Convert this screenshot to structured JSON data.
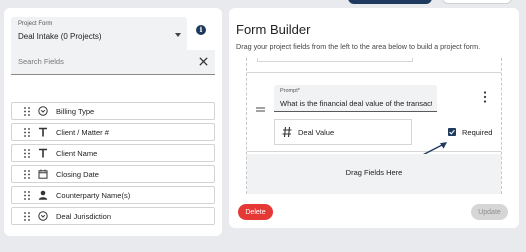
{
  "left_panel": {
    "project_form": {
      "label": "Project Form",
      "value": "Deal Intake (0 Projects)"
    },
    "search": {
      "placeholder": "Search Fields"
    },
    "fields": [
      {
        "label": "Billing Type",
        "icon": "dropdown-circle-icon"
      },
      {
        "label": "Client / Matter #",
        "icon": "text-t-icon"
      },
      {
        "label": "Client Name",
        "icon": "text-t-icon"
      },
      {
        "label": "Closing Date",
        "icon": "calendar-icon"
      },
      {
        "label": "Counterparty Name(s)",
        "icon": "person-icon"
      },
      {
        "label": "Deal Jurisdiction",
        "icon": "dropdown-circle-icon"
      }
    ]
  },
  "right_panel": {
    "title": "Form Builder",
    "subtitle": "Drag your project fields from the left to the area below to build a project form.",
    "field_card": {
      "prompt_label": "Prompt*",
      "prompt_value": "What is the financial deal value of the transaction?",
      "field_name": "Deal Value",
      "required_label": "Required",
      "required_checked": true
    },
    "drop_zone": "Drag Fields Here",
    "delete_label": "Delete",
    "update_label": "Update"
  },
  "colors": {
    "navy": "#1e3a5f",
    "danger": "#e53935",
    "disabled": "#d6d6d6"
  }
}
